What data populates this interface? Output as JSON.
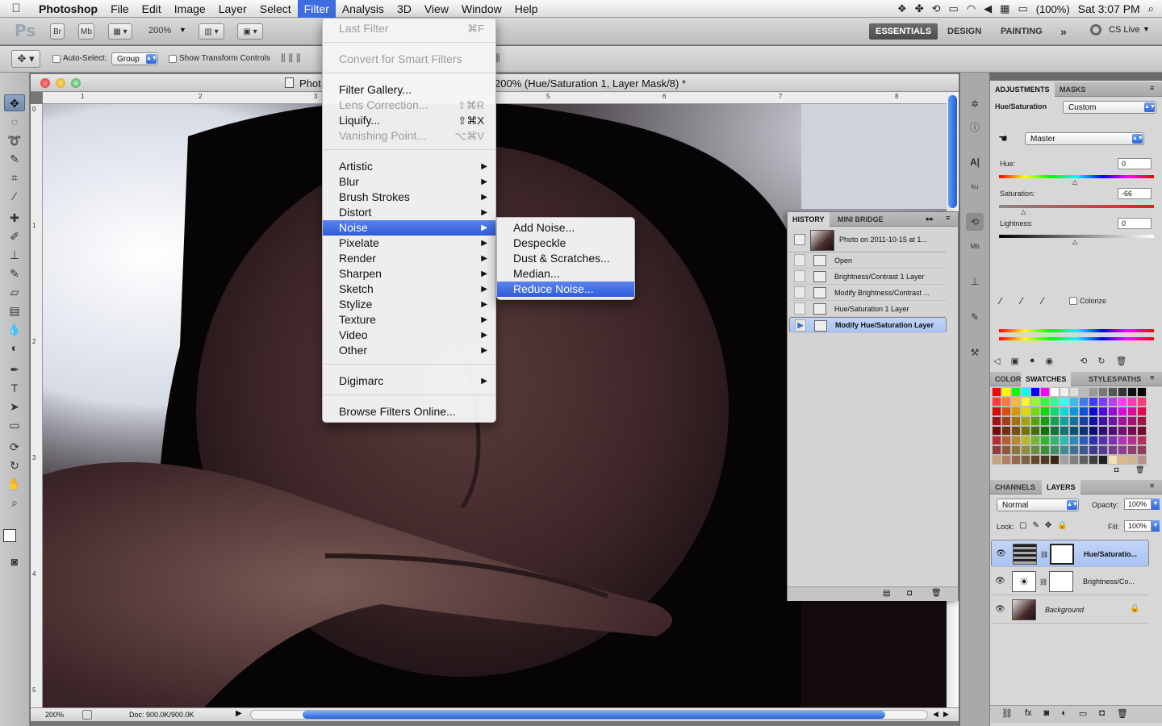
{
  "menubar": {
    "app_name": "Photoshop",
    "items": [
      "File",
      "Edit",
      "Image",
      "Layer",
      "Select",
      "Filter",
      "Analysis",
      "3D",
      "View",
      "Window",
      "Help"
    ],
    "active_item": "Filter",
    "battery": "(100%)",
    "clock": "Sat 3:07 PM"
  },
  "appbar": {
    "logo": "Ps",
    "br": "Br",
    "mb": "Mb",
    "zoom": "200%",
    "workspaces": [
      "ESSENTIALS",
      "DESIGN",
      "PAINTING"
    ],
    "more": "»",
    "cs_live": "CS Live"
  },
  "options": {
    "auto_select_label": "Auto-Select:",
    "auto_select_value": "Group",
    "transform_label": "Show Transform Controls"
  },
  "document": {
    "title_prefix": "Phot",
    "title_suffix": "200% (Hue/Saturation 1, Layer Mask/8) *",
    "ruler_h": [
      "1",
      "2",
      "3",
      "5",
      "6",
      "7",
      "8"
    ],
    "ruler_v": [
      "0",
      "1",
      "2",
      "3",
      "4",
      "5"
    ],
    "zoom": "200%",
    "doc_info": "Doc: 900.0K/900.0K"
  },
  "filter_menu": {
    "items": [
      {
        "label": "Last Filter",
        "shortcut": "⌘F",
        "disabled": true
      },
      {
        "label": "Convert for Smart Filters",
        "disabled": true
      },
      {
        "label": "Filter Gallery...",
        "disabled": false
      },
      {
        "label": "Lens Correction...",
        "shortcut": "⇧⌘R",
        "disabled": true
      },
      {
        "label": "Liquify...",
        "shortcut": "⇧⌘X",
        "disabled": false
      },
      {
        "label": "Vanishing Point...",
        "shortcut": "⌥⌘V",
        "disabled": true
      },
      {
        "label": "Artistic"
      },
      {
        "label": "Blur"
      },
      {
        "label": "Brush Strokes"
      },
      {
        "label": "Distort"
      },
      {
        "label": "Noise"
      },
      {
        "label": "Pixelate"
      },
      {
        "label": "Render"
      },
      {
        "label": "Sharpen"
      },
      {
        "label": "Sketch"
      },
      {
        "label": "Stylize"
      },
      {
        "label": "Texture"
      },
      {
        "label": "Video"
      },
      {
        "label": "Other"
      },
      {
        "label": "Digimarc"
      },
      {
        "label": "Browse Filters Online..."
      }
    ]
  },
  "noise_submenu": {
    "items": [
      "Add Noise...",
      "Despeckle",
      "Dust & Scratches...",
      "Median...",
      "Reduce Noise..."
    ],
    "highlighted": "Reduce Noise..."
  },
  "history": {
    "tabs": [
      "HISTORY",
      "MINI BRIDGE"
    ],
    "snapshot": "Photo on 2011-10-15 at 1...",
    "steps": [
      "Open",
      "Brightness/Contrast 1 Layer",
      "Modify Brightness/Contrast ...",
      "Hue/Saturation 1 Layer",
      "Modify Hue/Saturation Layer"
    ],
    "current": "Modify Hue/Saturation Layer"
  },
  "adjustments": {
    "tabs": [
      "ADJUSTMENTS",
      "MASKS"
    ],
    "type_label": "Hue/Saturation",
    "preset": "Custom",
    "channel": "Master",
    "hue_label": "Hue:",
    "hue_value": "0",
    "saturation_label": "Saturation:",
    "saturation_value": "-66",
    "lightness_label": "Lightness:",
    "lightness_value": "0",
    "colorize_label": "Colorize"
  },
  "swatches": {
    "tabs": [
      "COLOR",
      "SWATCHES",
      "STYLES",
      "PATHS"
    ]
  },
  "layers": {
    "tabs": [
      "CHANNELS",
      "LAYERS"
    ],
    "blend_mode": "Normal",
    "opacity_label": "Opacity:",
    "opacity": "100%",
    "lock_label": "Lock:",
    "fill_label": "Fill:",
    "fill": "100%",
    "items": [
      "Hue/Saturatio...",
      "Brightness/Co...",
      "Background"
    ],
    "selected": "Hue/Saturatio..."
  },
  "colors": {
    "highlight": "#3d6de0",
    "panel": "#d7d7d7"
  }
}
